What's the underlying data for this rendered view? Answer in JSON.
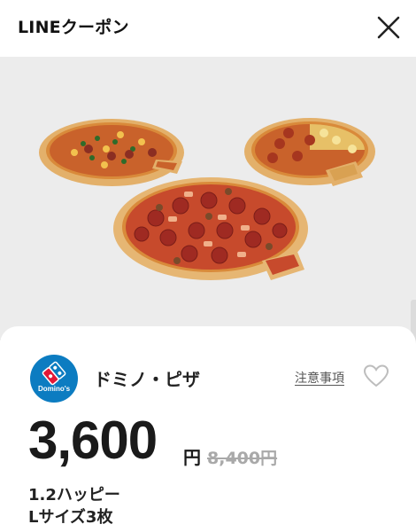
{
  "header": {
    "title": "LINEクーポン",
    "close_icon": "close-icon"
  },
  "hero": {
    "image_subject": "three-pizzas",
    "colors": {
      "background": "#ececec",
      "crust": "#d9a15b",
      "sauce": "#c8402d"
    }
  },
  "coupon": {
    "brand_logo_text": "Domino's",
    "brand_name": "ドミノ・ピザ",
    "notes_label": "注意事項",
    "favorite_icon": "heart-icon",
    "price": "3,600",
    "currency": "円",
    "original_price": "8,400円",
    "description_line1": "1.2ハッピー",
    "description_line2": "Lサイズ3枚"
  },
  "colors": {
    "logo_blue": "#0c7cc1",
    "logo_red": "#e31837",
    "strike_gray": "#a9a9a9"
  }
}
